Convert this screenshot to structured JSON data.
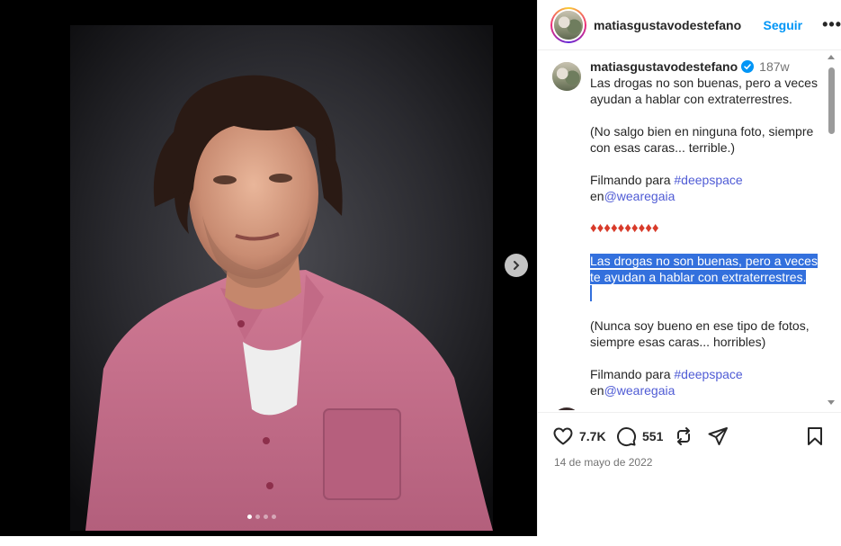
{
  "post": {
    "username": "matiasgustavodestefano",
    "follow_label": "Seguir",
    "more_label": "•••",
    "date": "14 de mayo de 2022"
  },
  "caption": {
    "username": "matiasgustavodestefano",
    "time": "187w",
    "p1": "Las drogas no son buenas, pero a veces ayudan a hablar con extraterrestres.",
    "p2": "(No salgo bien en ninguna foto, siempre con esas caras... terrible.)",
    "p3_prefix": "Filmando para ",
    "p3_tag": "#deepspace",
    "p3_mid": "en",
    "p3_mention": "@wearegaia",
    "diamonds": "♦♦♦♦♦♦♦♦♦♦",
    "p4_line1": "Las drogas no son buenas, pero a veces",
    "p4_line2": "te ayudan a hablar con extraterrestres.",
    "p5": "(Nunca soy bueno en ese tipo de fotos, siempre esas caras... horribles)",
    "p6_prefix": "Filmando para ",
    "p6_tag": "#deepspace",
    "p6_mid": "en",
    "p6_mention": "@wearegaia"
  },
  "actions": {
    "likes": "7.7K",
    "comments": "551"
  },
  "carousel": {
    "slide_count": 4,
    "active_index": 0
  },
  "colors": {
    "accent_blue": "#0095f6",
    "link_blue": "#4f5bd5",
    "selection": "#3370dd",
    "diamond_red": "#d83b2a"
  },
  "icons": {
    "like": "heart-icon",
    "comment": "comment-bubble-icon",
    "repost": "repost-icon",
    "share": "send-icon",
    "save": "bookmark-icon",
    "verified": "verified-badge-icon",
    "next": "chevron-right-icon"
  }
}
